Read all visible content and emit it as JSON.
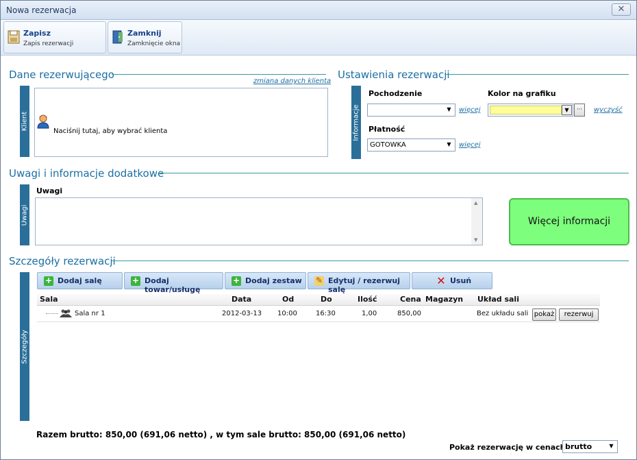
{
  "window": {
    "title": "Nowa rezerwacja",
    "close": "✕"
  },
  "toolbar": {
    "save": {
      "label": "Zapisz",
      "sub": "Zapis rezerwacji"
    },
    "close": {
      "label": "Zamknij",
      "sub": "Zamknięcie okna"
    }
  },
  "client": {
    "section_title": "Dane rezerwującego",
    "change_link": "zmiana danych klienta",
    "tab": "Klient",
    "prompt": "Naciśnij tutaj, aby wybrać klienta"
  },
  "settings": {
    "section_title": "Ustawienia rezerwacji",
    "tab": "Informacje",
    "origin_label": "Pochodzenie",
    "origin_value": "",
    "color_label": "Kolor na grafiku",
    "color_value": "#ffff99",
    "payment_label": "Płatność",
    "payment_value": "GOTOWKA",
    "more_link": "więcej",
    "more_link2": "więcej",
    "clear_link": "wyczyść",
    "ellipsis": "···"
  },
  "notes": {
    "section_title": "Uwagi i informacje dodatkowe",
    "tab": "Uwagi",
    "label": "Uwagi",
    "value": "",
    "more_info_button": "Więcej informacji"
  },
  "details": {
    "section_title": "Szczegóły rezerwacji",
    "tab": "Szczegóły",
    "buttons": {
      "add_hall": "Dodaj salę",
      "add_item": "Dodaj towar/usługę",
      "add_set": "Dodaj zestaw",
      "edit": "Edytuj / rezerwuj salę",
      "delete": "Usuń"
    },
    "columns": [
      "Sala",
      "Data",
      "Od",
      "Do",
      "Ilość",
      "Cena",
      "Magazyn",
      "Układ sali"
    ],
    "rows": [
      {
        "sala": "Sala nr 1",
        "data": "2012-03-13",
        "od": "10:00",
        "do": "16:30",
        "ilosc": "1,00",
        "cena": "850,00",
        "magazyn": "",
        "uklad": "Bez układu sali",
        "show_btn": "pokaż",
        "reserve_btn": "rezerwuj"
      }
    ]
  },
  "footer": {
    "total": "Razem brutto: 850,00 (691,06 netto) , w tym sale brutto: 850,00 (691,06 netto)",
    "price_mode_label": "Pokaż rezerwację w cenach",
    "price_mode_value": "brutto"
  },
  "colors": {
    "accent": "#1a6fa4",
    "tab": "#2a6f99",
    "green": "#7dff7d"
  }
}
